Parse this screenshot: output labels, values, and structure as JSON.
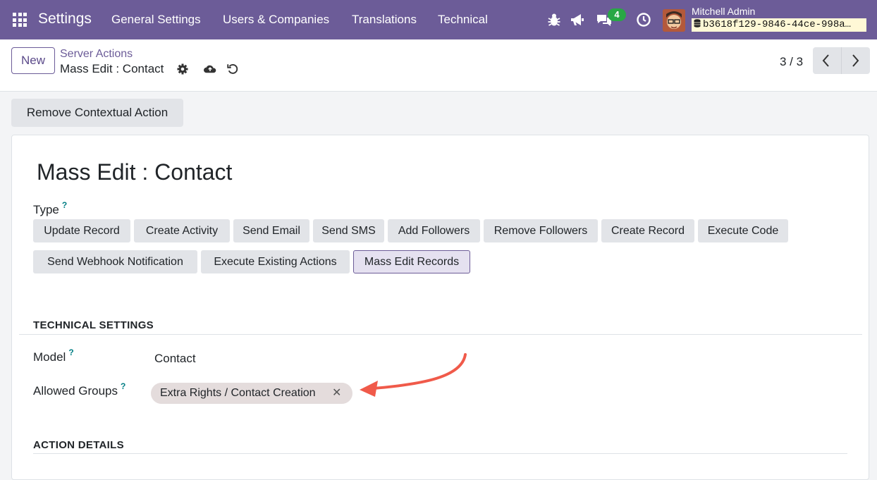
{
  "navbar": {
    "brand": "Settings",
    "menus": [
      "General Settings",
      "Users & Companies",
      "Translations",
      "Technical"
    ],
    "message_count": "4",
    "user_name": "Mitchell Admin",
    "db_name": "b3618f129-9846-44ce-998a…",
    "icons": [
      "apps-icon",
      "bug-icon",
      "megaphone-icon",
      "chat-icon",
      "clock-icon"
    ]
  },
  "control": {
    "new_label": "New",
    "breadcrumb_parent": "Server Actions",
    "breadcrumb_current": "Mass Edit : Contact",
    "pager": "3 / 3"
  },
  "actions": {
    "remove_contextual": "Remove Contextual Action"
  },
  "form": {
    "title": "Mass Edit : Contact",
    "type_label": "Type",
    "help_mark": "?",
    "types": [
      "Update Record",
      "Create Activity",
      "Send Email",
      "Send SMS",
      "Add Followers",
      "Remove Followers",
      "Create Record",
      "Execute Code",
      "Send Webhook Notification",
      "Execute Existing Actions",
      "Mass Edit Records"
    ],
    "active_type": "Mass Edit Records",
    "technical_settings_heading": "TECHNICAL SETTINGS",
    "model_label": "Model",
    "model_value": "Contact",
    "allowed_groups_label": "Allowed Groups",
    "allowed_groups_tag": "Extra Rights / Contact Creation",
    "tag_remove": "✕",
    "action_details_heading": "ACTION DETAILS"
  },
  "colors": {
    "navbar": "#6c5c98",
    "accent_teal": "#017e84",
    "annotation_arrow": "#f05a4a"
  }
}
